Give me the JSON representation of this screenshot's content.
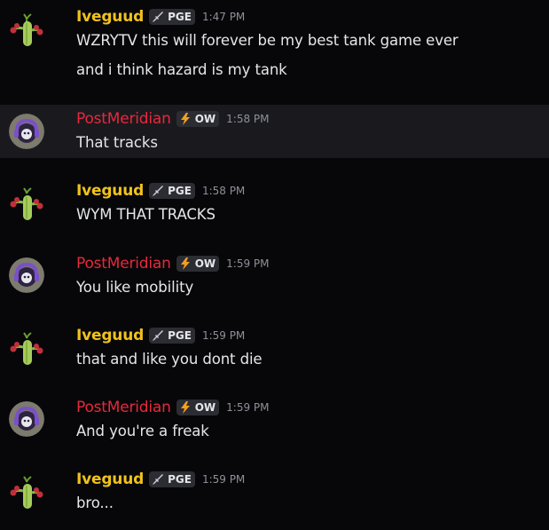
{
  "messages": [
    {
      "author": "Iveguud",
      "tag": "PGE",
      "time": "1:47 PM",
      "lines": [
        "WZRYTV this will forever be my best tank game ever",
        "and i think hazard is my tank"
      ]
    },
    {
      "author": "PostMeridian",
      "tag": "OW",
      "time": "1:58 PM",
      "lines": [
        "That tracks"
      ]
    },
    {
      "author": "Iveguud",
      "tag": "PGE",
      "time": "1:58 PM",
      "lines": [
        "WYM THAT TRACKS"
      ]
    },
    {
      "author": "PostMeridian",
      "tag": "OW",
      "time": "1:59 PM",
      "lines": [
        "You like mobility"
      ]
    },
    {
      "author": "Iveguud",
      "tag": "PGE",
      "time": "1:59 PM",
      "lines": [
        "that and like you dont die"
      ]
    },
    {
      "author": "PostMeridian",
      "tag": "OW",
      "time": "1:59 PM",
      "lines": [
        "And you're a freak"
      ]
    },
    {
      "author": "Iveguud",
      "tag": "PGE",
      "time": "1:59 PM",
      "lines": [
        "bro..."
      ]
    }
  ],
  "colors": {
    "background": "#070709",
    "hover_background": "#1a1a1e",
    "iveguud_name": "#f0c21c",
    "postmeridian_name": "#e8283c",
    "tag_background": "#2c2d33",
    "timestamp": "#8e9099",
    "message_text": "#e5e6ea"
  },
  "icons": {
    "iveguud_avatar": "cactus-avatar-icon",
    "postmeridian_avatar": "headset-avatar-icon",
    "pge_tag": "sword-icon",
    "ow_tag": "lightning-icon"
  }
}
